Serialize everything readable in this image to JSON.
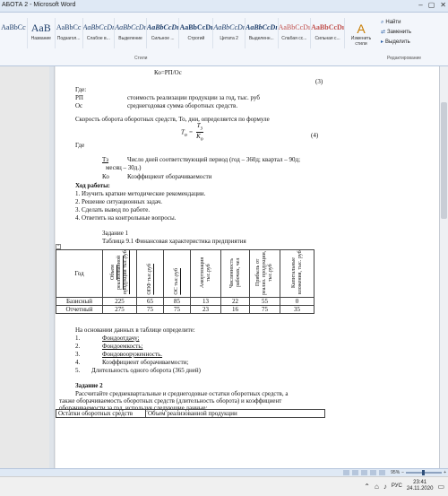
{
  "window": {
    "title": "АБОТА 2 - Microsoft Word",
    "controls": [
      "–",
      "▢",
      "✕"
    ]
  },
  "ribbon": {
    "styles": [
      {
        "sample": "AaBbCc",
        "name": ""
      },
      {
        "sample": "AaB",
        "name": "Название"
      },
      {
        "sample": "AaBbCc",
        "name": "Подзагол..."
      },
      {
        "sample": "AaBbCcDı",
        "name": "Слабое в..."
      },
      {
        "sample": "AaBbCcDı",
        "name": "Выделение"
      },
      {
        "sample": "AaBbCcDı",
        "name": "Сильное ..."
      },
      {
        "sample": "AaBbCcDı",
        "name": "Строгий"
      },
      {
        "sample": "AaBbCcDı",
        "name": "Цитата 2"
      },
      {
        "sample": "AaBbCcDı",
        "name": "Выделенн..."
      },
      {
        "sample": "AaBbCcDı",
        "name": "Слабая сс..."
      },
      {
        "sample": "AaBbCcDı",
        "name": "Сильная с..."
      }
    ],
    "styles_group_label": "Стили",
    "change_styles_label": "Изменить стили",
    "editing": {
      "find": "Найти",
      "replace": "Заменить",
      "select": "Выделить",
      "group_label": "Редактирование"
    }
  },
  "doc": {
    "top_formula": "Ко=РП/Ос",
    "eq3": "(3)",
    "where1": "Где:",
    "rp_sym": "РП",
    "rp_desc": "стоимость реализации продукции за год, тыс. руб",
    "os_sym": "Ос",
    "os_desc": "среднегодовая сумма оборотных средств.",
    "speed_text": "Скорость оборота оборотных средств, То, дни, определяется по формуле",
    "formula_left": "T",
    "formula_left_sub": "о",
    "formula_num": "Т",
    "formula_num_sub": "з",
    "formula_den": "К",
    "formula_den_sub": "о",
    "eq4": "(4)",
    "where2": "Где",
    "tz_sym": "Тз",
    "tz_desc": "Число дней соответствующий период (год – 360д; квартал – 90д;",
    "tz_desc2": "месяц – 30д.)",
    "ko_sym": "Ко",
    "ko_desc": "Коэффициент оборачиваемости",
    "work_heading": "Ход работы:",
    "work_steps": [
      "1.  Изучить краткие методические рекомендации.",
      "2.  Решение ситуационных задач.",
      "3.  Сделать вывод по работе.",
      "4.  Ответить на контрольные вопросы."
    ],
    "task1": "Задание 1",
    "table_caption": "Таблица 9.1 Финансовая характеристика предприятия",
    "table": {
      "headers": [
        "Год",
        "Объем реализованной продукции тыс.руб",
        "ОПФ тыс.руб",
        "ОС тыс.руб",
        "Амортизация тыс.руб",
        "Численность рабочих, чел",
        "Прибыль от реализ. продукции, тыс.руб",
        "Капитальные вложения, тыс. руб"
      ],
      "rows": [
        [
          "Базисный",
          "225",
          "65",
          "85",
          "13",
          "22",
          "55",
          "0"
        ],
        [
          "Отчетный",
          "275",
          "75",
          "75",
          "23",
          "16",
          "75",
          "35"
        ]
      ]
    },
    "determine": "На основании данных в таблице определите:",
    "determine_items": [
      {
        "num": "1.",
        "text": "Фондоотдачу;"
      },
      {
        "num": "2.",
        "text": "Фондоемкость;"
      },
      {
        "num": "3.",
        "text": "Фондовооруженность."
      },
      {
        "num": "4.",
        "text": "Коэффициент оборачиваемости;"
      },
      {
        "num": "5.",
        "text": "Длительность одного оборота (365 дней)"
      }
    ],
    "task2": "Задание 2",
    "task2_text1": "Рассчитайте среднеквартальные и среднегодовые остатки оборотных средств, а",
    "task2_text2": "также оборачиваемость оборотных средств (длительность оборота) и коэффициент",
    "task2_text3": "оборачиваемости за год, используя следующие данные:",
    "t2_col1": "Остатки оборотных средств",
    "t2_col2": "Объем реализованной продукции"
  },
  "statusbar": {
    "zoom": "95%"
  },
  "taskbar": {
    "lang": "РУС",
    "time": "23:41",
    "date": "24.11.2020"
  }
}
